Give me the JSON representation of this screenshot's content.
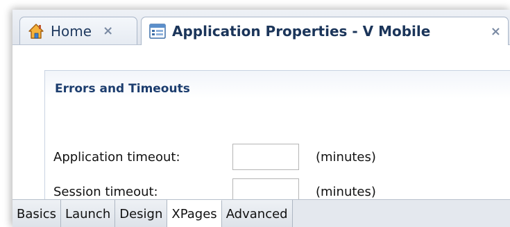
{
  "editor_tabs": [
    {
      "label": "Home",
      "icon": "home-icon",
      "closable": true,
      "active": false
    },
    {
      "label": "Application Properties - V Mobile",
      "icon": "application-properties-icon",
      "closable": true,
      "active": true
    }
  ],
  "close_glyph": "×",
  "section": {
    "title": "Errors and Timeouts",
    "application_timeout": {
      "label": "Application timeout:",
      "value": "",
      "unit": "(minutes)"
    },
    "session_timeout": {
      "label": "Session timeout:",
      "value": "",
      "unit": "(minutes)"
    }
  },
  "bottom_tabs": [
    {
      "label": "Basics",
      "active": false
    },
    {
      "label": "Launch",
      "active": false
    },
    {
      "label": "Design",
      "active": false
    },
    {
      "label": "XPages",
      "active": true
    },
    {
      "label": "Advanced",
      "active": false
    }
  ],
  "colors": {
    "title_blue": "#1c3d6e",
    "tab_border": "#a9b6c8",
    "home_icon_orange": "#f0a030"
  }
}
